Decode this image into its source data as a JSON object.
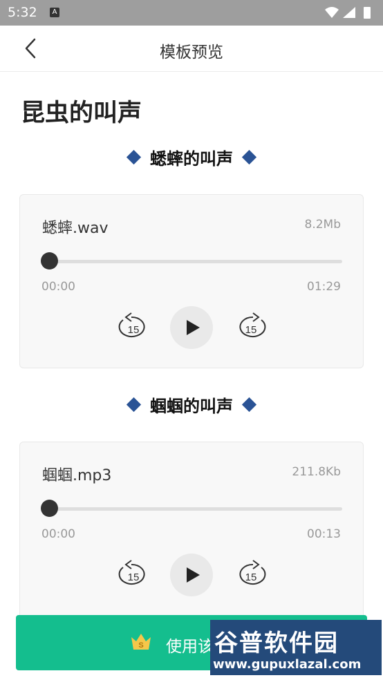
{
  "status_bar": {
    "time": "5:32",
    "badge": "A",
    "icons": [
      "wifi-icon",
      "signal-icon",
      "battery-icon"
    ]
  },
  "header": {
    "title": "模板预览",
    "back_icon": "chevron-left-icon"
  },
  "page": {
    "title": "昆虫的叫声"
  },
  "sections": [
    {
      "heading": "蟋蟀的叫声",
      "player": {
        "file_name": "蟋蟀.wav",
        "file_size": "8.2Mb",
        "time_current": "00:00",
        "time_total": "01:29",
        "progress": 0,
        "rewind_label": "15",
        "forward_label": "15"
      }
    },
    {
      "heading": "蝈蝈的叫声",
      "player": {
        "file_name": "蝈蝈.mp3",
        "file_size": "211.8Kb",
        "time_current": "00:00",
        "time_total": "00:13",
        "progress": 0,
        "rewind_label": "15",
        "forward_label": "15"
      }
    }
  ],
  "bottom_button": {
    "label": "使用该",
    "icon": "crown-icon"
  },
  "watermark": {
    "title": "谷普软件园",
    "url": "www.gupuxlazal.com"
  },
  "colors": {
    "accent": "#14be8e",
    "diamond": "#2a5395",
    "status_bar": "#9e9e9e"
  }
}
